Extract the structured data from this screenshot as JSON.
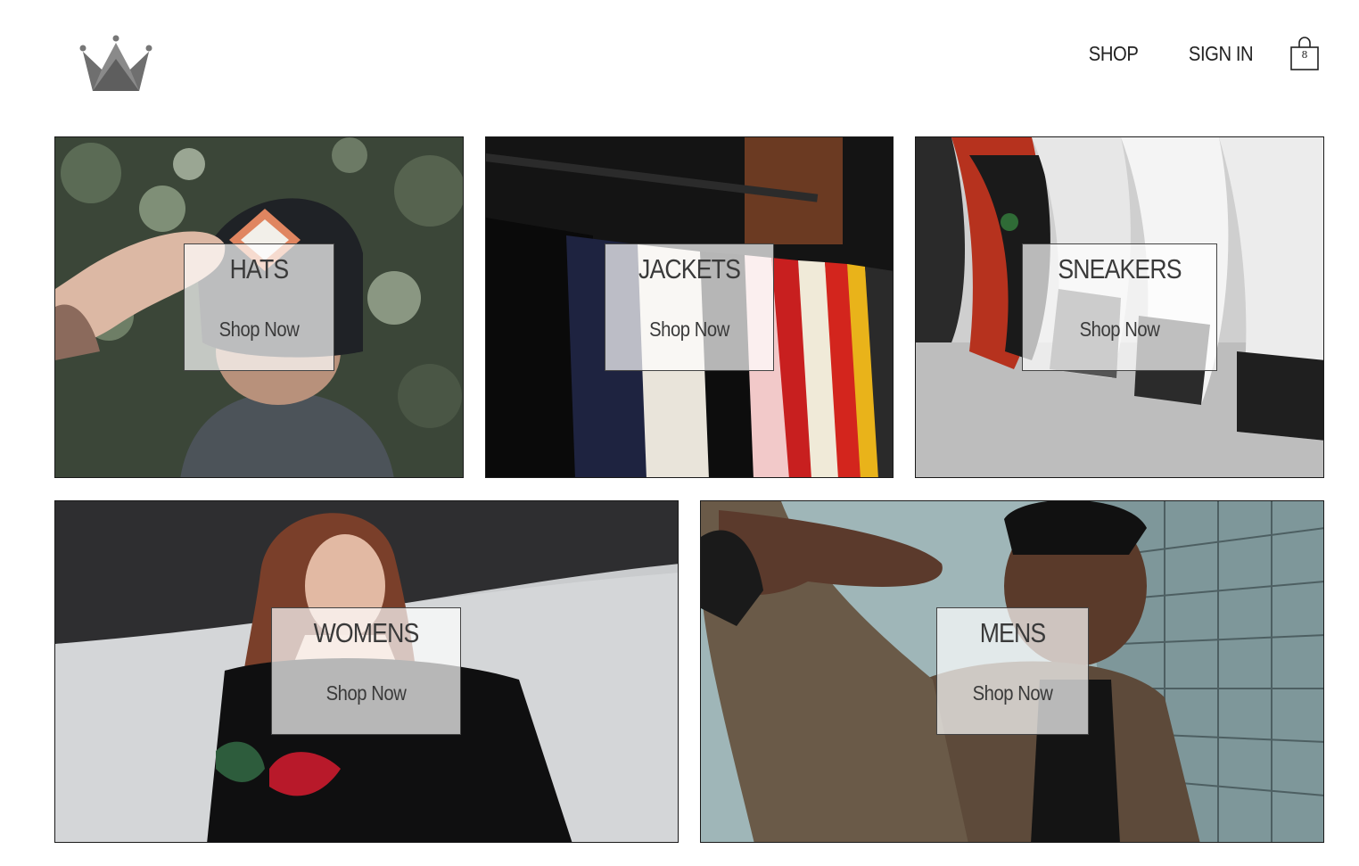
{
  "header": {
    "logo_icon": "crown-icon",
    "nav": {
      "shop_label": "SHOP",
      "sign_in_label": "SIGN IN",
      "cart_icon": "shopping-bag-icon",
      "cart_count": "8"
    }
  },
  "categories": [
    {
      "title": "HATS",
      "cta": "Shop Now"
    },
    {
      "title": "JACKETS",
      "cta": "Shop Now"
    },
    {
      "title": "SNEAKERS",
      "cta": "Shop Now"
    },
    {
      "title": "WOMENS",
      "cta": "Shop Now"
    },
    {
      "title": "MENS",
      "cta": "Shop Now"
    }
  ]
}
